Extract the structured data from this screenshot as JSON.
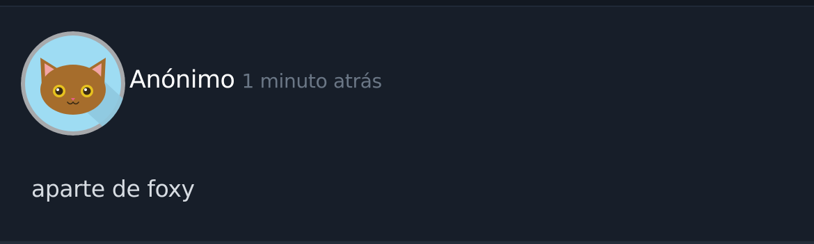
{
  "comment": {
    "author": "Anónimo",
    "time": "1 minuto atrás",
    "text": "aparte de foxy",
    "avatar_icon": "cat-avatar-icon"
  },
  "colors": {
    "background": "#171e29",
    "author_text": "#ffffff",
    "time_text": "#6b7786",
    "body_text": "#d7dce2",
    "avatar_ring": "#a7a9ac",
    "avatar_bg": "#9edcf3"
  }
}
